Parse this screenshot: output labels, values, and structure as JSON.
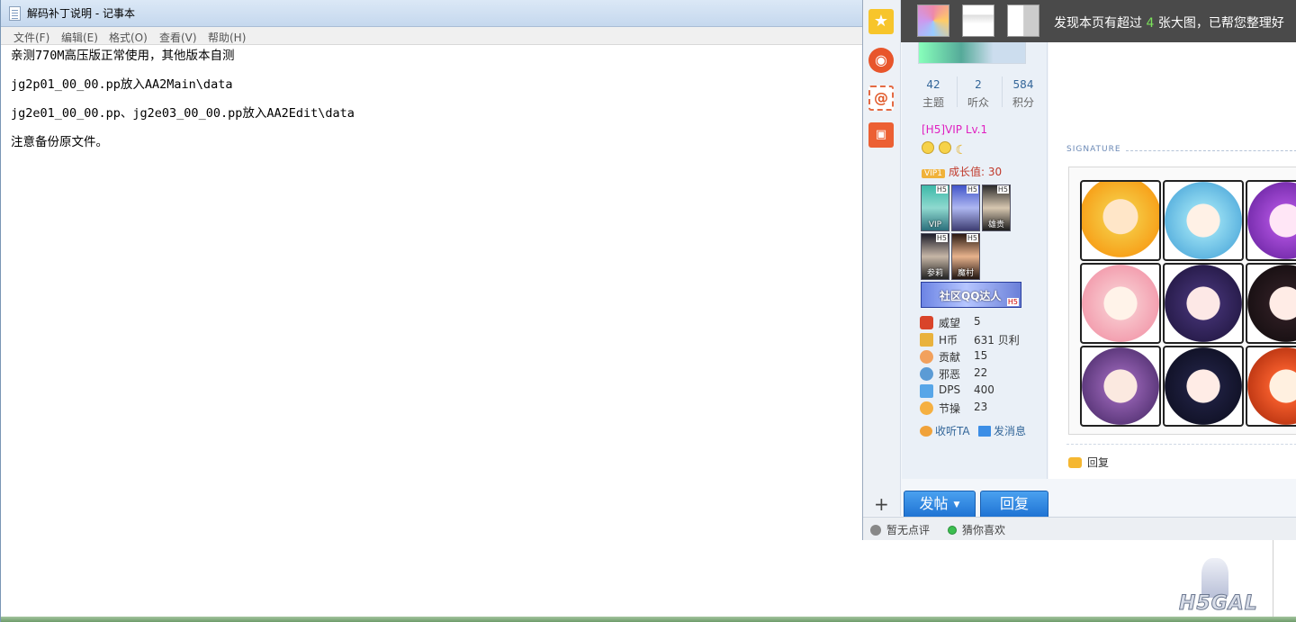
{
  "notepad": {
    "title": "解码补丁说明 - 记事本",
    "menu": [
      "文件(F)",
      "编辑(E)",
      "格式(O)",
      "查看(V)",
      "帮助(H)"
    ],
    "lines": [
      "亲测770M高压版正常使用，其他版本自测",
      "jg2p01_00_00.pp放入AA2Main\\data",
      "jg2e01_00_00.pp、jg2e03_00_00.pp放入AA2Edit\\data",
      "注意备份原文件。"
    ]
  },
  "browser": {
    "banner": {
      "prefix": "发现本页有超过 ",
      "count": "4",
      "suffix": " 张大图，已帮您整理好"
    },
    "profile": {
      "stats": [
        {
          "value": "42",
          "label": "主题"
        },
        {
          "value": "2",
          "label": "听众"
        },
        {
          "value": "584",
          "label": "积分"
        }
      ],
      "vip_level": "[H5]VIP Lv.1",
      "growth_badge": "VIP1",
      "growth": "成长值: 30",
      "medals": [
        {
          "tag": "H5",
          "caption": "VIP"
        },
        {
          "tag": "H5",
          "caption": ""
        },
        {
          "tag": "H5",
          "caption": "雄贵"
        },
        {
          "tag": "H5",
          "caption": "参莉"
        },
        {
          "tag": "H5",
          "caption": "魔村"
        }
      ],
      "qq_banner": "社区QQ达人",
      "qq_tag": "H5",
      "credits": [
        {
          "name": "威望",
          "value": "5"
        },
        {
          "name": "H币",
          "value": "631 贝利"
        },
        {
          "name": "贡献",
          "value": "15"
        },
        {
          "name": "邪恶",
          "value": "22"
        },
        {
          "name": "DPS",
          "value": "400"
        },
        {
          "name": "节操",
          "value": "23"
        }
      ],
      "follow": "收听TA",
      "message": "发消息"
    },
    "signature_label": "SIGNATURE",
    "reply_link": "回复",
    "post_button": "发帖",
    "reply_button": "回复",
    "status": {
      "comment": "暂无点评",
      "like": "猜你喜欢"
    }
  },
  "watermark": "H5GAL"
}
